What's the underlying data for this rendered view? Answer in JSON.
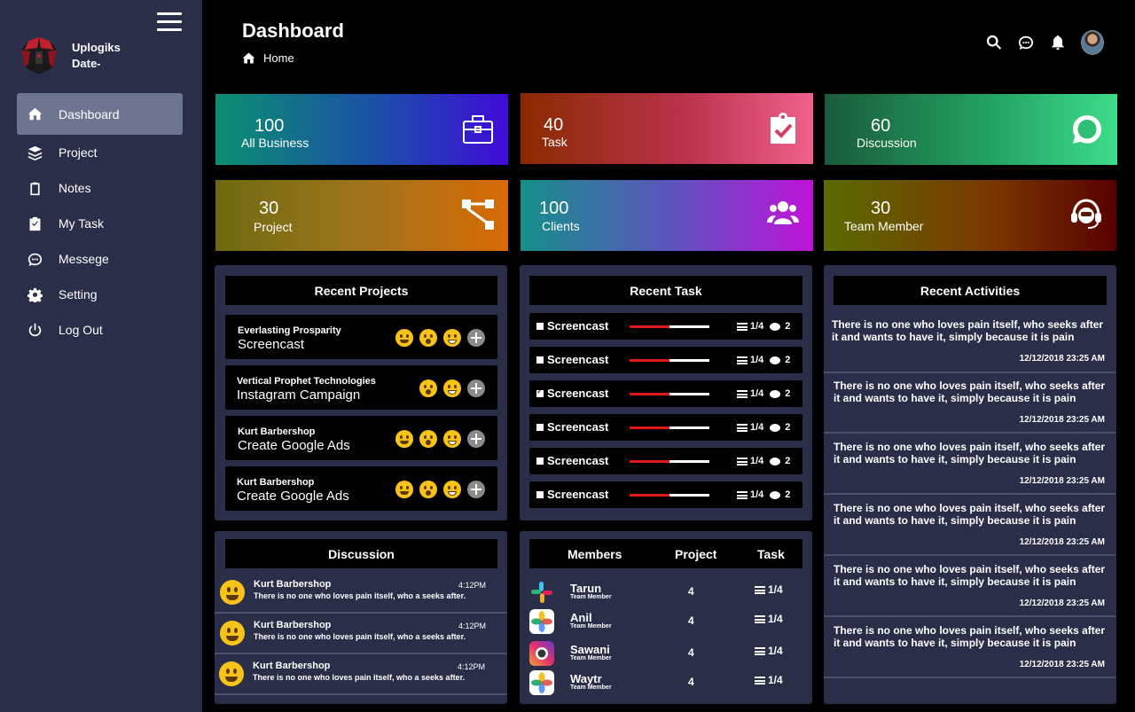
{
  "sidebar": {
    "brand": {
      "line1": "Uplogiks",
      "line2": "Date-"
    },
    "items": [
      {
        "label": "Dashboard",
        "icon": "home-icon"
      },
      {
        "label": "Project",
        "icon": "layers-icon"
      },
      {
        "label": "Notes",
        "icon": "clipboard-icon"
      },
      {
        "label": "My Task",
        "icon": "task-check-icon"
      },
      {
        "label": "Messege",
        "icon": "chat-bubble-icon"
      },
      {
        "label": "Setting",
        "icon": "gear-icon"
      },
      {
        "label": "Log Out",
        "icon": "power-icon"
      }
    ]
  },
  "header": {
    "title": "Dashboard",
    "breadcrumb": "Home"
  },
  "stats": [
    {
      "value": "100",
      "label": "All Business",
      "icon": "briefcase-icon"
    },
    {
      "value": "40",
      "label": "Task",
      "icon": "clipboard-check-icon"
    },
    {
      "value": "60",
      "label": "Discussion",
      "icon": "whatsapp-bubble-icon"
    },
    {
      "value": "30",
      "label": "Project",
      "icon": "sitemap-icon"
    },
    {
      "value": "100",
      "label": "Clients",
      "icon": "users-icon"
    },
    {
      "value": "30",
      "label": "Team Member",
      "icon": "headset-icon"
    }
  ],
  "recent_projects": {
    "title": "Recent Projects",
    "rows": [
      {
        "client": "Everlasting Prosparity",
        "name": "Screencast"
      },
      {
        "client": "Vertical Prophet Technologies",
        "name": "Instagram Campaign"
      },
      {
        "client": "Kurt Barbershop",
        "name": "Create Google Ads"
      },
      {
        "client": "Kurt Barbershop",
        "name": "Create Google Ads"
      }
    ]
  },
  "recent_task": {
    "title": "Recent Task",
    "rows": [
      {
        "name": "Screencast",
        "progress": 0.5,
        "count": "1/4",
        "comments": "2",
        "checked": false
      },
      {
        "name": "Screencast",
        "progress": 0.5,
        "count": "1/4",
        "comments": "2",
        "checked": false
      },
      {
        "name": "Screencast",
        "progress": 0.5,
        "count": "1/4",
        "comments": "2",
        "checked": true
      },
      {
        "name": "Screencast",
        "progress": 0.5,
        "count": "1/4",
        "comments": "2",
        "checked": false
      },
      {
        "name": "Screencast",
        "progress": 0.5,
        "count": "1/4",
        "comments": "2",
        "checked": false
      },
      {
        "name": "Screencast",
        "progress": 0.5,
        "count": "1/4",
        "comments": "2",
        "checked": false
      }
    ]
  },
  "recent_activities": {
    "title": "Recent Activities",
    "items": [
      {
        "text": "There is no one who loves pain itself, who seeks after it and wants to have it, simply because it is pain",
        "date": "12/12/2018 23:25 AM"
      },
      {
        "text": "There is no one who loves pain itself, who seeks after it and wants to have it, simply because it is pain",
        "date": "12/12/2018 23:25 AM"
      },
      {
        "text": "There is no one who loves pain itself, who seeks after it and wants to have it, simply because it is pain",
        "date": "12/12/2018 23:25 AM"
      },
      {
        "text": "There is no one who loves pain itself, who seeks after it and wants to have it, simply because it is pain",
        "date": "12/12/2018 23:25 AM"
      },
      {
        "text": "There is no one who loves pain itself, who seeks after it and wants to have it, simply because it is pain",
        "date": "12/12/2018 23:25 AM"
      },
      {
        "text": "There is no one who loves pain itself, who seeks after it and wants to have it, simply because it is pain",
        "date": "12/12/2018 23:25 AM"
      }
    ]
  },
  "discussion": {
    "title": "Discussion",
    "rows": [
      {
        "name": "Kurt Barbershop",
        "time": "4:12PM",
        "message": "There is no one who loves pain itself, who a seeks after."
      },
      {
        "name": "Kurt Barbershop",
        "time": "4:12PM",
        "message": "There is no one who loves pain itself, who a seeks after."
      },
      {
        "name": "Kurt Barbershop",
        "time": "4:12PM",
        "message": "There is no one who loves pain itself, who a seeks after."
      }
    ]
  },
  "members": {
    "headers": {
      "members": "Members",
      "project": "Project",
      "task": "Task"
    },
    "rows": [
      {
        "name": "Tarun",
        "role": "Team Member",
        "project": "4",
        "task": "1/4",
        "icon": "slack-icon"
      },
      {
        "name": "Anil",
        "role": "Team Member",
        "project": "4",
        "task": "1/4",
        "icon": "photos-icon"
      },
      {
        "name": "Sawani",
        "role": "Team Member",
        "project": "4",
        "task": "1/4",
        "icon": "instagram-icon"
      },
      {
        "name": "Waytr",
        "role": "Team Member",
        "project": "4",
        "task": "1/4",
        "icon": "photos-icon"
      }
    ]
  },
  "colors": {
    "sidebar_bg": "#2a2e48",
    "panel_bg": "#2a2e48",
    "active_nav": "#6f7591",
    "progress_red": "#e01818"
  }
}
